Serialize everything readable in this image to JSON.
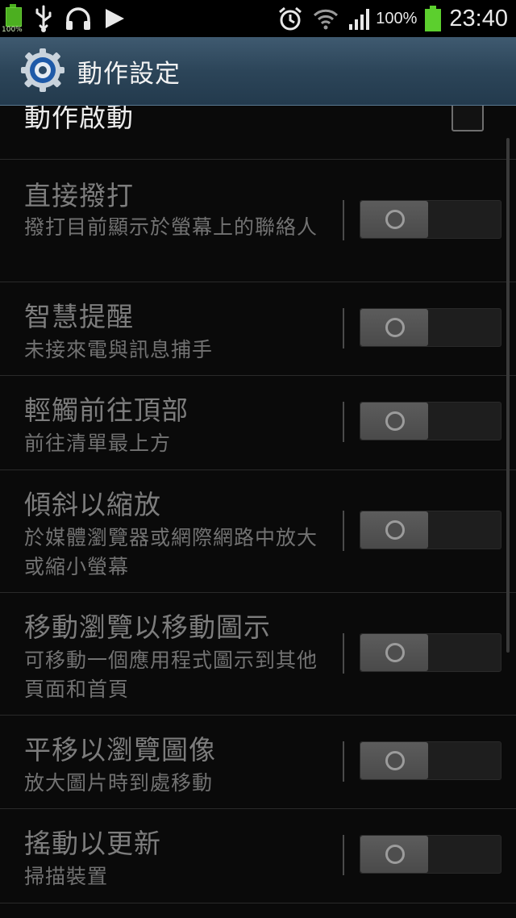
{
  "status_bar": {
    "mini_battery_percent": "100%",
    "battery_percent": "100%",
    "time": "23:40",
    "icons": [
      "usb-icon",
      "headphones-icon",
      "play-icon",
      "alarm-icon",
      "wifi-icon",
      "signal-icon",
      "battery-icon"
    ]
  },
  "action_bar": {
    "title": "動作設定",
    "icon": "settings-gear-icon"
  },
  "master": {
    "title": "動作啟動",
    "checked": false
  },
  "items": [
    {
      "title": "直接撥打",
      "summary": "撥打目前顯示於螢幕上的聯絡人",
      "enabled": false
    },
    {
      "title": "智慧提醒",
      "summary": "未接來電與訊息捕手",
      "enabled": false
    },
    {
      "title": "輕觸前往頂部",
      "summary": "前往清單最上方",
      "enabled": false
    },
    {
      "title": "傾斜以縮放",
      "summary": "於媒體瀏覽器或網際網路中放大或縮小螢幕",
      "enabled": false
    },
    {
      "title": "移動瀏覽以移動圖示",
      "summary": "可移動一個應用程式圖示到其他頁面和首頁",
      "enabled": false
    },
    {
      "title": "平移以瀏覽圖像",
      "summary": "放大圖片時到處移動",
      "enabled": false
    },
    {
      "title": "搖動以更新",
      "summary": "掃描裝置",
      "enabled": false
    }
  ],
  "colors": {
    "action_bar": "#2c4559",
    "battery_green": "#5ccf2e",
    "disabled_text": "#7d7d7d"
  }
}
